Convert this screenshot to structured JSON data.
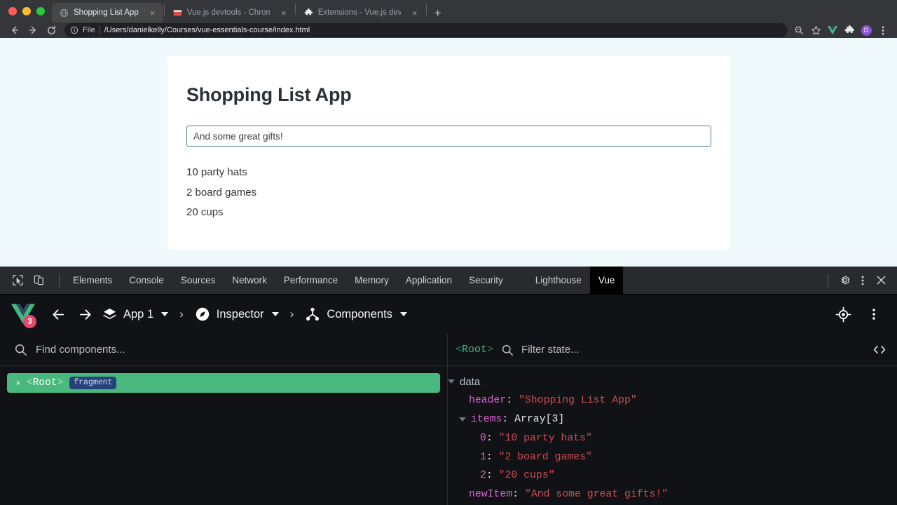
{
  "browser": {
    "tabs": [
      {
        "title": "Shopping List App",
        "favicon": "globe-icon",
        "active": true
      },
      {
        "title": "Vue.js devtools - Chrome Web",
        "favicon": "chrome-store-icon",
        "active": false
      },
      {
        "title": "Extensions - Vue.js devtools",
        "favicon": "puzzle-icon",
        "active": false
      }
    ],
    "new_tab_label": "+",
    "close_label": "×",
    "omnibox": {
      "scheme_label": "File",
      "url": "/Users/danielkelly/Courses/vue-essentials-course/index.html",
      "info_icon": "info-circle-icon"
    },
    "nav": {
      "back": "←",
      "forward": "→",
      "reload": "⟳"
    },
    "actions": [
      "zoom-search-icon",
      "bookmark-star-icon",
      "vue-devtools-extension-icon",
      "extensions-puzzle-icon",
      "profile-avatar",
      "chrome-menu-icon"
    ],
    "profile_initial": "D"
  },
  "page": {
    "title": "Shopping List App",
    "new_item_value": "And some great gifts!",
    "items": [
      "10 party hats",
      "2 board games",
      "20 cups"
    ],
    "background_color": "#f0f9fb",
    "card_color": "#ffffff",
    "input_border_color": "#5d808f"
  },
  "devtools": {
    "tool_icons": [
      "inspect-element-icon",
      "device-toolbar-icon"
    ],
    "panels": [
      {
        "label": "Elements",
        "active": false
      },
      {
        "label": "Console",
        "active": false
      },
      {
        "label": "Sources",
        "active": false
      },
      {
        "label": "Network",
        "active": false
      },
      {
        "label": "Performance",
        "active": false
      },
      {
        "label": "Memory",
        "active": false
      },
      {
        "label": "Application",
        "active": false
      },
      {
        "label": "Security",
        "active": false
      },
      {
        "label": "Lighthouse",
        "active": false
      },
      {
        "label": "Vue",
        "active": true
      }
    ],
    "right_actions": [
      "settings-gear-icon",
      "more-options-icon",
      "close-devtools-icon"
    ]
  },
  "vue_devtools": {
    "logo": {
      "name": "vue-logo",
      "badge": "3",
      "badge_color": "#e3476a",
      "brand_color": "#42b883"
    },
    "nav_back": "←",
    "nav_forward": "→",
    "breadcrumb": [
      {
        "label": "App 1",
        "icon": "layers-icon",
        "has_caret": true
      },
      {
        "label": "Inspector",
        "icon": "compass-icon",
        "has_caret": true
      },
      {
        "label": "Components",
        "icon": "component-tree-icon",
        "has_caret": true
      }
    ],
    "separator": "›",
    "right_actions": [
      "select-component-target-icon",
      "more-options-icon"
    ],
    "tree_panel": {
      "search_placeholder": "Find components...",
      "search_icon": "search-icon",
      "selected_row": {
        "name": "Root",
        "open_angle": "<",
        "close_angle": ">",
        "badge": "fragment",
        "selected_color": "#49b87f"
      }
    },
    "state_panel": {
      "component_tag": "Root",
      "open_angle": "<",
      "close_angle": ">",
      "filter_placeholder": "Filter state...",
      "search_icon": "search-icon",
      "code_toggle_icon": "angle-brackets-icon",
      "groups": [
        {
          "name": "data",
          "expanded": true,
          "entries": [
            {
              "key": "header",
              "value": "\"Shopping List App\"",
              "type": "string",
              "indent": 2
            },
            {
              "key": "items",
              "value": "Array[3]",
              "type": "meta",
              "indent": 1,
              "expandable": true
            },
            {
              "key": "0",
              "value": "\"10 party hats\"",
              "type": "string",
              "indent": 3
            },
            {
              "key": "1",
              "value": "\"2 board games\"",
              "type": "string",
              "indent": 3
            },
            {
              "key": "2",
              "value": "\"20 cups\"",
              "type": "string",
              "indent": 3
            },
            {
              "key": "newItem",
              "value": "\"And some great gifts!\"",
              "type": "string",
              "indent": 2
            }
          ]
        }
      ]
    }
  }
}
